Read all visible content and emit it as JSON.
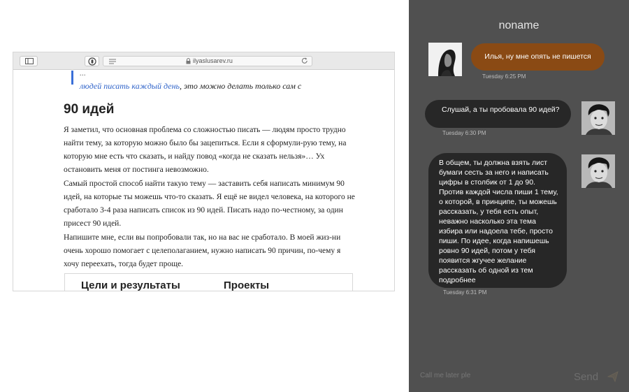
{
  "browser": {
    "url": "ilyaslusarev.ru",
    "quote_clipped": "...",
    "quote_link": "",
    "quote_line2_link": "людей писать каждый день",
    "quote_line2_rest": ", это можно делать только сам с",
    "article_title": "90 идей",
    "paragraphs": [
      "Я заметил, что основная проблема со сложностью писать — людям просто трудно найти тему, за которую можно было бы зацепиться. Если я сформули-рую тему, на которую мне есть что сказать, и найду повод «когда не сказать нельзя»… Ух остановить меня от постинга невозможно.",
      "Самый простой способ найти такую тему — заставить себя написать минимум 90 идей, на которые ты можешь что-то сказать. Я ещё не видел человека, на которого не сработало 3-4 раза написать список из 90 идей. Писать надо по-честному, за один присест 90 идей.",
      "Напишите мне, если вы попробовали так, но на вас не сработало. В моей жиз-ни очень хорошо помогает с целеполаганием, нужно написать 90 причин, по-чему я хочу переехать, тогда будет проще."
    ],
    "table_headers": [
      "Цели и результаты",
      "Проекты"
    ]
  },
  "chat": {
    "title": "noname",
    "messages": [
      {
        "text": "Илья, ну мне опять не пишется",
        "time": "Tuesday 6:25 PM"
      },
      {
        "text": "Слушай, а ты пробовала 90 идей?",
        "time": "Tuesday 6:30 PM"
      },
      {
        "text": "В общем, ты должна взять лист бумаги сесть за него и написать цифры в столбик от 1 до 90. Против каждой числа пиши 1 тему, о которой, в принципе, ты можешь рассказать, у тебя есть опыт, неважно насколько эта тема избира или надоела тебе, просто пиши. По идее, когда напишешь ровно 90 идей, потом у тебя появится жгучее желание рассказать об одной из тем подробнее",
        "time": "Tuesday 6:31 PM"
      }
    ],
    "input_placeholder": "Call me later ple",
    "send_label": "Send",
    "colors": {
      "panel": "#505050",
      "incoming_bubble": "#8a4a14",
      "outgoing_bubble": "#272727"
    }
  }
}
